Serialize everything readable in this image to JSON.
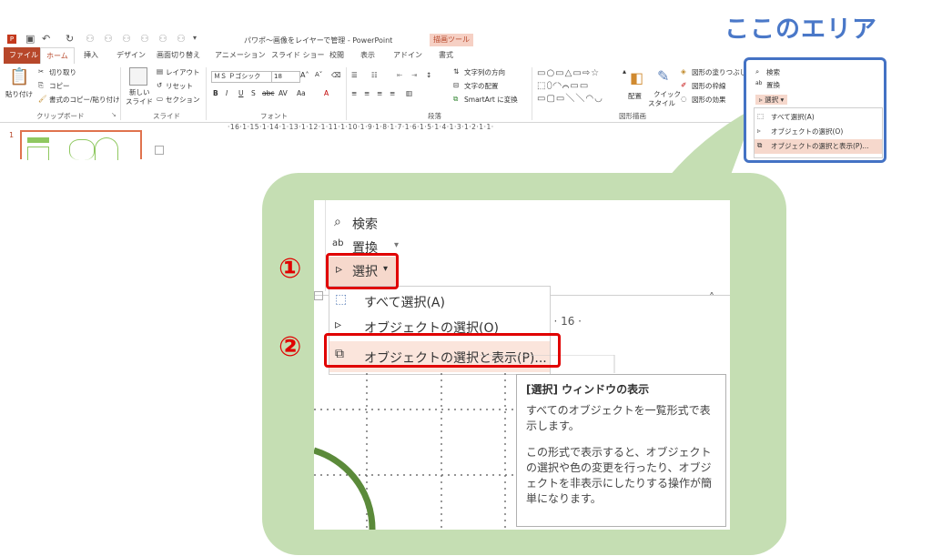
{
  "window": {
    "title": "パワポ～画像をレイヤーで管理 - PowerPoint",
    "tool_header": "描画ツール"
  },
  "tabs": [
    {
      "label": "ファイル"
    },
    {
      "label": "ホーム"
    },
    {
      "label": "挿入"
    },
    {
      "label": "デザイン"
    },
    {
      "label": "画面切り替え"
    },
    {
      "label": "アニメーション"
    },
    {
      "label": "スライド ショー"
    },
    {
      "label": "校閲"
    },
    {
      "label": "表示"
    },
    {
      "label": "アドイン"
    },
    {
      "label": "書式"
    }
  ],
  "ribbon": {
    "clipboard": {
      "paste": "貼り付け",
      "cut": "切り取り",
      "copy": "コピー",
      "format_painter": "書式のコピー/貼り付け",
      "group": "クリップボード"
    },
    "slides": {
      "new_slide_1": "新しい",
      "new_slide_2": "スライド",
      "layout": "レイアウト",
      "reset": "リセット",
      "section": "セクション",
      "group": "スライド"
    },
    "font": {
      "font_name": "ＭＳ Ｐゴシック",
      "font_size": "18",
      "group": "フォント"
    },
    "paragraph": {
      "text_direction": "文字列の方向",
      "align_text": "文字の配置",
      "smartart": "SmartArt に変換",
      "group": "段落"
    },
    "drawing": {
      "arrange": "配置",
      "quick_style_1": "クイック",
      "quick_style_2": "スタイル",
      "shape_fill": "図形の塗りつぶし",
      "shape_outline": "図形の枠線",
      "shape_effects": "図形の効果",
      "group": "図形描画"
    }
  },
  "ruler": "·16·1·15·1·14·1·13·1·12·1·11·1·10·1·9·1·8·1·7·1·6·1·5·1·4·1·3·1·2·1·1·",
  "slide_thumb_number": "1",
  "area_title": "ここのエリア",
  "small_box": {
    "find": "検索",
    "replace": "置換",
    "select": "選択",
    "select_all": "すべて選択(A)",
    "select_objects": "オブジェクトの選択(O)",
    "selection_pane": "オブジェクトの選択と表示(P)..."
  },
  "zoom": {
    "find": "検索",
    "replace": "置換",
    "select": "選択",
    "select_all": "すべて選択(A)",
    "select_objects": "オブジェクトの選択(O)",
    "selection_pane": "オブジェクトの選択と表示(P)...",
    "ruler_tail": "5 · 16 ·",
    "step1": "①",
    "step2": "②"
  },
  "tooltip": {
    "title": "[選択] ウィンドウの表示",
    "p1": "すべてのオブジェクトを一覧形式で表示します。",
    "p2": "この形式で表示すると、オブジェクトの選択や色の変更を行ったり、オブジェクトを非表示にしたりする操作が簡単になります。"
  },
  "colors": {
    "accent": "#b7472a",
    "area_blue": "#4472c4",
    "callout_green": "#c5deb3",
    "highlight_red": "#e00000"
  }
}
